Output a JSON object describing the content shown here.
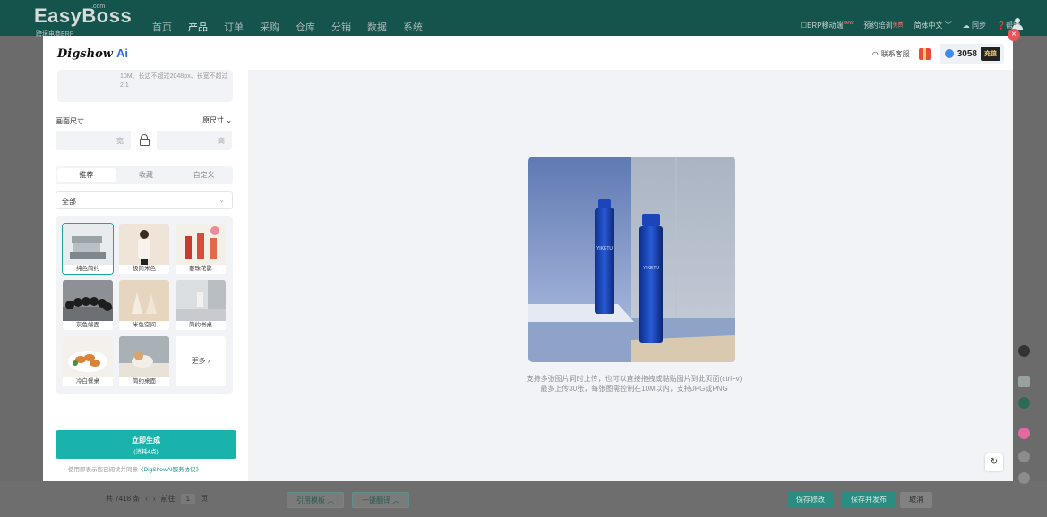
{
  "topnav": {
    "brand": "EasyBoss",
    "brand_com": ".com",
    "brand_sub": "跨境电商ERP",
    "menu": [
      "首页",
      "产品",
      "订单",
      "采购",
      "仓库",
      "分销",
      "数据",
      "系统"
    ],
    "active_menu": "产品",
    "right": {
      "erp_mobile": "ERP移动端",
      "erp_badge": "new",
      "training": "预约培训",
      "training_badge": "免费",
      "language": "简体中文",
      "sync": "同步",
      "help": "帮助"
    }
  },
  "modal": {
    "logo_text": "Digshow",
    "logo_ai": "Ai",
    "contact": "联系客服",
    "points": "3058",
    "recharge": "充值"
  },
  "left": {
    "upload_hint": "10M、长边不超过2048px、长宽不超过2:1",
    "canvas_size_label": "画面尺寸",
    "canvas_size_value": "原尺寸",
    "width_placeholder": "宽",
    "height_placeholder": "高",
    "tabs": [
      "推荐",
      "收藏",
      "自定义"
    ],
    "category": "全部",
    "templates": [
      "纯色简约",
      "极简米色",
      "蔓珠花影",
      "灰色端面",
      "米色空间",
      "简约书桌",
      "冷白餐桌",
      "简约桌面"
    ],
    "more": "更多 ›",
    "generate": "立即生成",
    "generate_cost": "(消耗4点)",
    "agree_prefix": "使用即表示您已阅读并同意",
    "agree_link": "《DigShowAI服务协议》"
  },
  "preview": {
    "product_brand": "YIKETU",
    "hint_line1": "支持多张图片同时上传，也可以直接拖拽或黏贴图片到此页面(ctrl+v)",
    "hint_line2": "最多上传30张，每张图需控制在10M以内，支持JPG或PNG"
  },
  "bottom": {
    "total": "共 7418 条",
    "goto": "前往",
    "page": "1",
    "page_unit": "页",
    "cite_template": "引用模板",
    "translate": "一键翻译",
    "save_edit": "保存修改",
    "save_publish": "保存并发布",
    "cancel": "取消"
  }
}
